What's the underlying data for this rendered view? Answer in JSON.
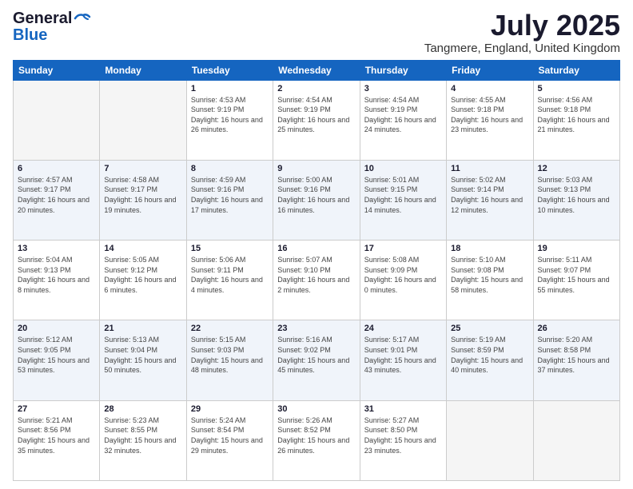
{
  "logo": {
    "general": "General",
    "blue": "Blue"
  },
  "title": "July 2025",
  "subtitle": "Tangmere, England, United Kingdom",
  "weekdays": [
    "Sunday",
    "Monday",
    "Tuesday",
    "Wednesday",
    "Thursday",
    "Friday",
    "Saturday"
  ],
  "weeks": [
    [
      {
        "day": "",
        "sunrise": "",
        "sunset": "",
        "daylight": ""
      },
      {
        "day": "",
        "sunrise": "",
        "sunset": "",
        "daylight": ""
      },
      {
        "day": "1",
        "sunrise": "Sunrise: 4:53 AM",
        "sunset": "Sunset: 9:19 PM",
        "daylight": "Daylight: 16 hours and 26 minutes."
      },
      {
        "day": "2",
        "sunrise": "Sunrise: 4:54 AM",
        "sunset": "Sunset: 9:19 PM",
        "daylight": "Daylight: 16 hours and 25 minutes."
      },
      {
        "day": "3",
        "sunrise": "Sunrise: 4:54 AM",
        "sunset": "Sunset: 9:19 PM",
        "daylight": "Daylight: 16 hours and 24 minutes."
      },
      {
        "day": "4",
        "sunrise": "Sunrise: 4:55 AM",
        "sunset": "Sunset: 9:18 PM",
        "daylight": "Daylight: 16 hours and 23 minutes."
      },
      {
        "day": "5",
        "sunrise": "Sunrise: 4:56 AM",
        "sunset": "Sunset: 9:18 PM",
        "daylight": "Daylight: 16 hours and 21 minutes."
      }
    ],
    [
      {
        "day": "6",
        "sunrise": "Sunrise: 4:57 AM",
        "sunset": "Sunset: 9:17 PM",
        "daylight": "Daylight: 16 hours and 20 minutes."
      },
      {
        "day": "7",
        "sunrise": "Sunrise: 4:58 AM",
        "sunset": "Sunset: 9:17 PM",
        "daylight": "Daylight: 16 hours and 19 minutes."
      },
      {
        "day": "8",
        "sunrise": "Sunrise: 4:59 AM",
        "sunset": "Sunset: 9:16 PM",
        "daylight": "Daylight: 16 hours and 17 minutes."
      },
      {
        "day": "9",
        "sunrise": "Sunrise: 5:00 AM",
        "sunset": "Sunset: 9:16 PM",
        "daylight": "Daylight: 16 hours and 16 minutes."
      },
      {
        "day": "10",
        "sunrise": "Sunrise: 5:01 AM",
        "sunset": "Sunset: 9:15 PM",
        "daylight": "Daylight: 16 hours and 14 minutes."
      },
      {
        "day": "11",
        "sunrise": "Sunrise: 5:02 AM",
        "sunset": "Sunset: 9:14 PM",
        "daylight": "Daylight: 16 hours and 12 minutes."
      },
      {
        "day": "12",
        "sunrise": "Sunrise: 5:03 AM",
        "sunset": "Sunset: 9:13 PM",
        "daylight": "Daylight: 16 hours and 10 minutes."
      }
    ],
    [
      {
        "day": "13",
        "sunrise": "Sunrise: 5:04 AM",
        "sunset": "Sunset: 9:13 PM",
        "daylight": "Daylight: 16 hours and 8 minutes."
      },
      {
        "day": "14",
        "sunrise": "Sunrise: 5:05 AM",
        "sunset": "Sunset: 9:12 PM",
        "daylight": "Daylight: 16 hours and 6 minutes."
      },
      {
        "day": "15",
        "sunrise": "Sunrise: 5:06 AM",
        "sunset": "Sunset: 9:11 PM",
        "daylight": "Daylight: 16 hours and 4 minutes."
      },
      {
        "day": "16",
        "sunrise": "Sunrise: 5:07 AM",
        "sunset": "Sunset: 9:10 PM",
        "daylight": "Daylight: 16 hours and 2 minutes."
      },
      {
        "day": "17",
        "sunrise": "Sunrise: 5:08 AM",
        "sunset": "Sunset: 9:09 PM",
        "daylight": "Daylight: 16 hours and 0 minutes."
      },
      {
        "day": "18",
        "sunrise": "Sunrise: 5:10 AM",
        "sunset": "Sunset: 9:08 PM",
        "daylight": "Daylight: 15 hours and 58 minutes."
      },
      {
        "day": "19",
        "sunrise": "Sunrise: 5:11 AM",
        "sunset": "Sunset: 9:07 PM",
        "daylight": "Daylight: 15 hours and 55 minutes."
      }
    ],
    [
      {
        "day": "20",
        "sunrise": "Sunrise: 5:12 AM",
        "sunset": "Sunset: 9:05 PM",
        "daylight": "Daylight: 15 hours and 53 minutes."
      },
      {
        "day": "21",
        "sunrise": "Sunrise: 5:13 AM",
        "sunset": "Sunset: 9:04 PM",
        "daylight": "Daylight: 15 hours and 50 minutes."
      },
      {
        "day": "22",
        "sunrise": "Sunrise: 5:15 AM",
        "sunset": "Sunset: 9:03 PM",
        "daylight": "Daylight: 15 hours and 48 minutes."
      },
      {
        "day": "23",
        "sunrise": "Sunrise: 5:16 AM",
        "sunset": "Sunset: 9:02 PM",
        "daylight": "Daylight: 15 hours and 45 minutes."
      },
      {
        "day": "24",
        "sunrise": "Sunrise: 5:17 AM",
        "sunset": "Sunset: 9:01 PM",
        "daylight": "Daylight: 15 hours and 43 minutes."
      },
      {
        "day": "25",
        "sunrise": "Sunrise: 5:19 AM",
        "sunset": "Sunset: 8:59 PM",
        "daylight": "Daylight: 15 hours and 40 minutes."
      },
      {
        "day": "26",
        "sunrise": "Sunrise: 5:20 AM",
        "sunset": "Sunset: 8:58 PM",
        "daylight": "Daylight: 15 hours and 37 minutes."
      }
    ],
    [
      {
        "day": "27",
        "sunrise": "Sunrise: 5:21 AM",
        "sunset": "Sunset: 8:56 PM",
        "daylight": "Daylight: 15 hours and 35 minutes."
      },
      {
        "day": "28",
        "sunrise": "Sunrise: 5:23 AM",
        "sunset": "Sunset: 8:55 PM",
        "daylight": "Daylight: 15 hours and 32 minutes."
      },
      {
        "day": "29",
        "sunrise": "Sunrise: 5:24 AM",
        "sunset": "Sunset: 8:54 PM",
        "daylight": "Daylight: 15 hours and 29 minutes."
      },
      {
        "day": "30",
        "sunrise": "Sunrise: 5:26 AM",
        "sunset": "Sunset: 8:52 PM",
        "daylight": "Daylight: 15 hours and 26 minutes."
      },
      {
        "day": "31",
        "sunrise": "Sunrise: 5:27 AM",
        "sunset": "Sunset: 8:50 PM",
        "daylight": "Daylight: 15 hours and 23 minutes."
      },
      {
        "day": "",
        "sunrise": "",
        "sunset": "",
        "daylight": ""
      },
      {
        "day": "",
        "sunrise": "",
        "sunset": "",
        "daylight": ""
      }
    ]
  ]
}
